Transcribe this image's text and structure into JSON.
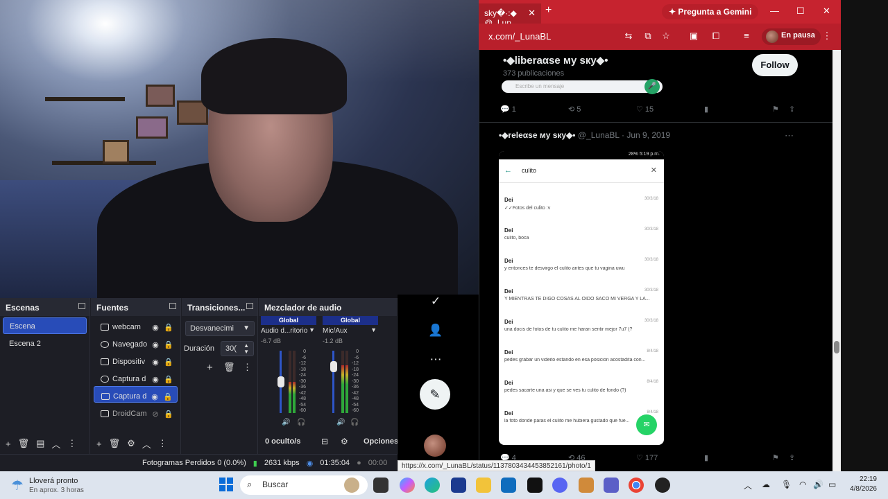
{
  "obs": {
    "scenes_title": "Escenas",
    "scenes": [
      {
        "label": "Escena",
        "selected": true
      },
      {
        "label": "Escena 2",
        "selected": false
      }
    ],
    "sources_title": "Fuentes",
    "sources": [
      {
        "label": "webcam",
        "icon": "camera-icon",
        "selected": false
      },
      {
        "label": "Navegado",
        "icon": "globe-icon",
        "selected": false
      },
      {
        "label": "Dispositiv",
        "icon": "camera-icon",
        "selected": false
      },
      {
        "label": "Captura d",
        "icon": "gamepad-icon",
        "selected": false
      },
      {
        "label": "Captura d",
        "icon": "monitor-icon",
        "selected": true
      },
      {
        "label": "DroidCam",
        "icon": "file-icon",
        "selected": false
      }
    ],
    "transitions_title": "Transiciones...",
    "transition_value": "Desvanecimi",
    "duration_label": "Duración",
    "duration_value": "30(",
    "mixer_title": "Mezclador de audio",
    "mixer_channels": [
      {
        "header": "Global",
        "name": "Audio d...ritorio",
        "db": "-6.7 dB",
        "level": 0.55
      },
      {
        "header": "Global",
        "name": "Mic/Aux",
        "db": "-1.2 dB",
        "level": 0.85
      }
    ],
    "meter_scale": [
      "0",
      "-6",
      "-12",
      "-18",
      "-24",
      "-30",
      "-36",
      "-42",
      "-48",
      "-54",
      "-60"
    ],
    "hidden_count": "0 oculto/s",
    "options_label": "Opciones",
    "status": {
      "dropped": "Fotogramas Perdidos 0 (0.0%)",
      "bitrate": "2631 kbps",
      "stream_time": "01:35:04",
      "rec_time": "00:00"
    }
  },
  "browser": {
    "tab_title": "sky�·:◆ @_Lun",
    "gemini_label": "Pregunta a Gemini",
    "url": "x.com/_LunaBL",
    "profile_status": "En pausa",
    "status_link": "https://x.com/_LunaBL/status/1137803434453852161/photo/1"
  },
  "x": {
    "profile_name": "•◆liberaαse мy sкy◆•",
    "post_count": "373 publicaciones",
    "follow_label": "Follow",
    "wa_placeholder": "Escribe un mensaje",
    "top_actions": {
      "replies": "1",
      "reposts": "5",
      "likes": "15"
    },
    "rt_name": "•◆releαse мy sкy◆•",
    "rt_handle": "@_LunaBL",
    "rt_date": "Jun 9, 2019",
    "bottom_actions": {
      "replies": "4",
      "reposts": "46",
      "likes": "177"
    },
    "phone": {
      "status_text": "28% 5:19 p.m.",
      "search_term": "culito",
      "messages": [
        {
          "who": "Dei",
          "date": "30/3/18",
          "text": "✓✓Fotos del culito :v"
        },
        {
          "who": "Dei",
          "date": "30/3/18",
          "text": "culito, boca"
        },
        {
          "who": "Dei",
          "date": "30/3/18",
          "text": "y entonces te desvirgo el culito antes que tu vagina uwu"
        },
        {
          "who": "Dei",
          "date": "30/3/18",
          "text": "Y MIENTRAS TE DIGO COSAS AL OIDO SACO MI VERGA Y LA..."
        },
        {
          "who": "Dei",
          "date": "30/3/18",
          "text": "una docis de fotos de tu culito me haran sentir mejor 7u7 (?"
        },
        {
          "who": "Dei",
          "date": "8/4/18",
          "text": "pedes grabar un videito estando en esa posicion acostadita con..."
        },
        {
          "who": "Dei",
          "date": "8/4/18",
          "text": "pedes sacarte una asi y que se ves tu culito de fondo (?)"
        },
        {
          "who": "Dei",
          "date": "8/4/18",
          "text": "la foto donde paras el culito me hubiera gustado que fue..."
        }
      ]
    }
  },
  "taskbar": {
    "weather_line1": "Lloverá pronto",
    "weather_line2": "En aprox. 3 horas",
    "search_placeholder": "Buscar",
    "time": "22:19",
    "date": "4/8/2026"
  }
}
